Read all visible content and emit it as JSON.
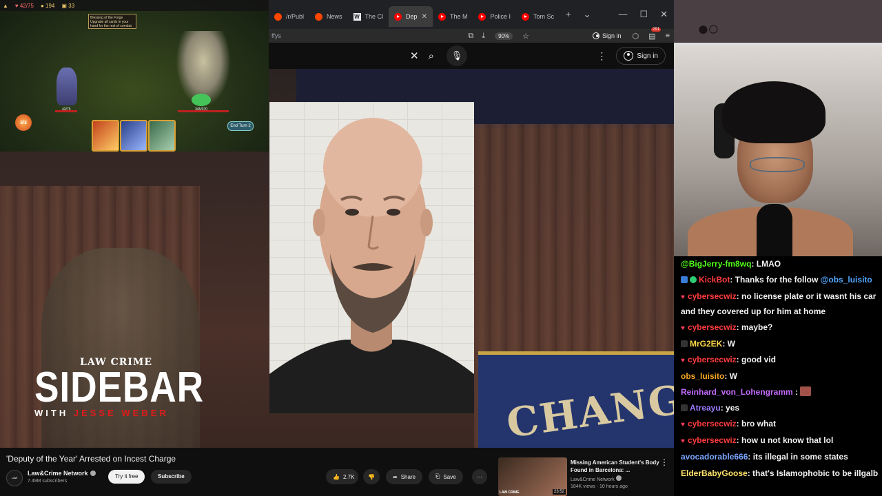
{
  "browser": {
    "tabs": [
      {
        "label": "/r/Publ",
        "icon": "reddit-icon",
        "active": false
      },
      {
        "label": "News",
        "icon": "reddit-icon",
        "active": false
      },
      {
        "label": "The Cl",
        "icon": "w-icon",
        "active": false
      },
      {
        "label": "Dep",
        "icon": "youtube-icon",
        "active": true
      },
      {
        "label": "The M",
        "icon": "youtube-icon",
        "active": false
      },
      {
        "label": "Police I",
        "icon": "youtube-icon",
        "active": false
      },
      {
        "label": "Tom Sc",
        "icon": "youtube-icon",
        "active": false
      }
    ],
    "new_tab": "+",
    "tab_list": "⌄",
    "minimize": "—",
    "maximize": "☐",
    "close": "✕",
    "url_fragment": "ffys",
    "zoom": "90%",
    "signin": "Sign in",
    "notification_count": "291"
  },
  "youtube": {
    "signin": "Sign in",
    "video_title": "'Deputy of the Year' Arrested on Incest Charge",
    "channel_name": "Law&Crime Network",
    "subscribers": "7.49M subscribers",
    "try_free": "Try it free",
    "subscribe": "Subscribe",
    "likes": "2.7K",
    "share": "Share",
    "save": "Save",
    "video_logo": {
      "top": "LAW CRIME",
      "main": "SIDEBAR",
      "sub_with": "WITH",
      "sub_name": "JESSE WEBER"
    },
    "banner_text": "CHANGE C",
    "recommended": {
      "title": "Missing American Student's Body Found in Barcelona: ...",
      "channel": "Law&Crime Network",
      "meta": "184K views · 10 hours ago",
      "duration": "23:52",
      "thumb_logo": "LAW CRIME"
    }
  },
  "game": {
    "hp": "42/75",
    "gold": "194",
    "floor": "33",
    "tooltip": "Blessing of the Forge Upgrade all cards in your hand for the rest of combat.",
    "player_hp": "42/75",
    "enemy_hp": "345/370",
    "energy": "3/3",
    "end_turn": "End Turn 2"
  },
  "chat": [
    {
      "user": "@BigJerry-fm8wq",
      "color": "#53fc18",
      "text": ": LMAO",
      "heart": false
    },
    {
      "user": "KickBot",
      "color": "#ff3c3c",
      "text": ": Thanks for the follow ",
      "mention": "@obs_luisito",
      "badges": "bot",
      "heart": false
    },
    {
      "user": "cybersecwiz",
      "color": "#ff3c3c",
      "text": ": no license plate or it wasnt his car and they covered up for him at home",
      "heart": true
    },
    {
      "user": "cybersecwiz",
      "color": "#ff3c3c",
      "text": ": maybe?",
      "heart": true
    },
    {
      "user": "MrG2EK",
      "color": "#ffd84a",
      "text": ": W",
      "heart": false
    },
    {
      "user": "cybersecwiz",
      "color": "#ff3c3c",
      "text": ": good vid",
      "heart": true
    },
    {
      "user": "obs_luisito",
      "color": "#f5a623",
      "text": ": W",
      "heart": false
    },
    {
      "user": "Reinhard_von_Lohengramm",
      "color": "#c46bff",
      "text": " :",
      "heart": false,
      "emote": true
    },
    {
      "user": "Atreayu",
      "color": "#9b7bff",
      "text": ": yes",
      "heart": false
    },
    {
      "user": "cybersecwiz",
      "color": "#ff3c3c",
      "text": ": bro what",
      "heart": true
    },
    {
      "user": "cybersecwiz",
      "color": "#ff3c3c",
      "text": ": how u not know that lol",
      "heart": true
    },
    {
      "user": "avocadorable666",
      "color": "#7aa5ff",
      "text": ": its illegal in some states",
      "heart": false
    },
    {
      "user": "ElderBabyGoose",
      "color": "#ffe36b",
      "text": ": that's Islamophobic to be illgalb",
      "heart": false
    }
  ],
  "colors": {
    "yt_red": "#ff0000",
    "chat_bg": "#000000",
    "page_bg": "#0f0f0f"
  }
}
